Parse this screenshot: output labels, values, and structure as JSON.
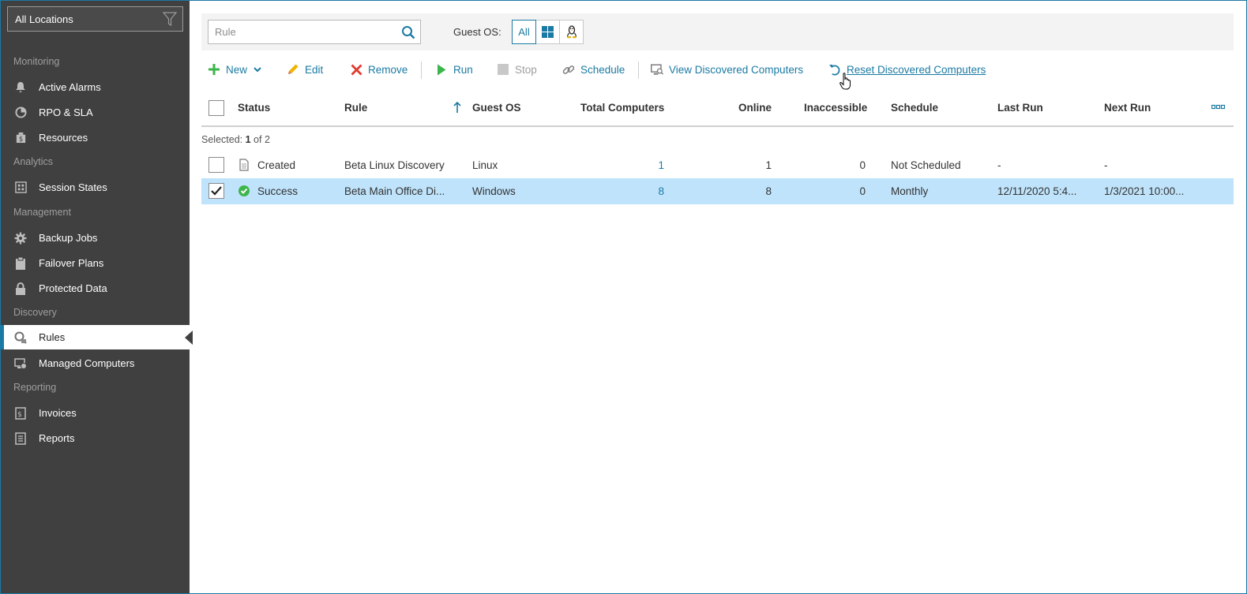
{
  "sidebar": {
    "location": "All Locations",
    "sections": [
      {
        "title": "Monitoring"
      },
      {
        "title": "Analytics"
      },
      {
        "title": "Management"
      },
      {
        "title": "Discovery"
      },
      {
        "title": "Reporting"
      }
    ],
    "items": [
      {
        "label": "Active Alarms",
        "icon": "bell-icon"
      },
      {
        "label": "RPO & SLA",
        "icon": "pie-chart-icon"
      },
      {
        "label": "Resources",
        "icon": "resources-icon"
      },
      {
        "label": "Session States",
        "icon": "session-grid-icon"
      },
      {
        "label": "Backup Jobs",
        "icon": "gear-icon"
      },
      {
        "label": "Failover Plans",
        "icon": "clipboard-icon"
      },
      {
        "label": "Protected Data",
        "icon": "lock-icon"
      },
      {
        "label": "Rules",
        "icon": "discovery-rule-icon",
        "active": true
      },
      {
        "label": "Managed Computers",
        "icon": "managed-computers-icon"
      },
      {
        "label": "Invoices",
        "icon": "invoice-icon"
      },
      {
        "label": "Reports",
        "icon": "report-icon"
      }
    ]
  },
  "filter": {
    "search_placeholder": "Rule",
    "guest_os_label": "Guest OS:",
    "os_options": [
      {
        "label": "All",
        "active": true
      },
      {
        "label": "",
        "icon": "windows-icon"
      },
      {
        "label": "",
        "icon": "linux-icon"
      }
    ]
  },
  "toolbar": {
    "new_label": "New",
    "edit_label": "Edit",
    "remove_label": "Remove",
    "run_label": "Run",
    "stop_label": "Stop",
    "schedule_label": "Schedule",
    "view_discovered_label": "View Discovered Computers",
    "reset_discovered_label": "Reset Discovered Computers"
  },
  "grid": {
    "columns": [
      "Status",
      "Rule",
      "Guest OS",
      "Total Computers",
      "Online",
      "Inaccessible",
      "Schedule",
      "Last Run",
      "Next Run"
    ],
    "selection_prefix": "Selected:",
    "selected_count": "1",
    "selection_suffix": "of 2",
    "rows": [
      {
        "checked": false,
        "status": "Created",
        "status_icon": "document-icon",
        "rule": "Beta Linux Discovery",
        "guest_os": "Linux",
        "total": "1",
        "online": "1",
        "inaccessible": "0",
        "schedule": "Not Scheduled",
        "last_run": "-",
        "next_run": "-"
      },
      {
        "checked": true,
        "status": "Success",
        "status_icon": "success-check-icon",
        "rule": "Beta Main Office Di...",
        "guest_os": "Windows",
        "total": "8",
        "online": "8",
        "inaccessible": "0",
        "schedule": "Monthly",
        "last_run": "12/11/2020 5:4...",
        "next_run": "1/3/2021 10:00..."
      }
    ]
  },
  "colors": {
    "sidebar_bg": "#404040",
    "accent": "#1b7aa3",
    "selected_row": "#bfe3fb",
    "success": "#3cb54a",
    "danger": "#e03c31"
  }
}
